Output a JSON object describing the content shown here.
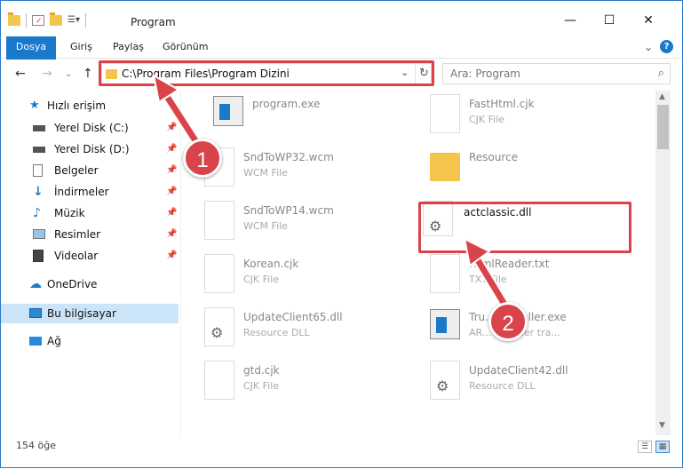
{
  "window": {
    "title": "Program",
    "minimize": "—",
    "maximize": "☐",
    "close": "✕"
  },
  "ribbon": {
    "tabs": [
      "Dosya",
      "Giriş",
      "Paylaş",
      "Görünüm"
    ],
    "help": "?",
    "expand": "⌄"
  },
  "nav": {
    "back": "←",
    "forward": "→",
    "recent": "⌄",
    "up": "↑",
    "address": "C:\\Program Files\\Program Dizini",
    "address_chevron": "⌄",
    "refresh": "↻",
    "search_placeholder": "Ara: Program",
    "search_icon": "⌕"
  },
  "sidebar": {
    "quick_access": "Hızlı erişim",
    "items": [
      {
        "label": "Yerel Disk (C:)",
        "icon": "drive-icon",
        "pinned": true
      },
      {
        "label": "Yerel Disk (D:)",
        "icon": "drive-icon",
        "pinned": true
      },
      {
        "label": "Belgeler",
        "icon": "documents-icon",
        "pinned": true
      },
      {
        "label": "İndirmeler",
        "icon": "downloads-icon",
        "pinned": true
      },
      {
        "label": "Müzik",
        "icon": "music-icon",
        "pinned": true
      },
      {
        "label": "Resimler",
        "icon": "pictures-icon",
        "pinned": true
      },
      {
        "label": "Videolar",
        "icon": "videos-icon",
        "pinned": true
      }
    ],
    "onedrive": "OneDrive",
    "this_pc": "Bu bilgisayar",
    "network": "Ağ",
    "pin_glyph": "📌"
  },
  "files": [
    {
      "name": "program.exe",
      "type": "",
      "icon": "exe-icon"
    },
    {
      "name": "FastHtml.cjk",
      "type": "CJK File",
      "icon": "file-icon"
    },
    {
      "name": "SndToWP32.wcm",
      "type": "WCM File",
      "icon": "file-icon"
    },
    {
      "name": "Resource",
      "type": "",
      "icon": "folder-icon"
    },
    {
      "name": "SndToWP14.wcm",
      "type": "WCM File",
      "icon": "file-icon"
    },
    {
      "name": "actclassic.dll",
      "type": "",
      "icon": "dll-icon"
    },
    {
      "name": "Korean.cjk",
      "type": "CJK File",
      "icon": "file-icon"
    },
    {
      "name": "HtmlReader.txt",
      "type": "TXT File",
      "icon": "file-icon"
    },
    {
      "name": "UpdateClient65.dll",
      "type": "Resource DLL",
      "icon": "dll-icon"
    },
    {
      "name": "Tru...dInstaller.exe",
      "type": "AR... Installer tra...",
      "icon": "exe-icon"
    },
    {
      "name": "gtd.cjk",
      "type": "CJK File",
      "icon": "file-icon"
    },
    {
      "name": "UpdateClient42.dll",
      "type": "Resource DLL",
      "icon": "dll-icon"
    }
  ],
  "status": {
    "count": "154 öğe"
  },
  "annotations": {
    "step1": "1",
    "step2": "2",
    "accent": "#d9434a"
  }
}
